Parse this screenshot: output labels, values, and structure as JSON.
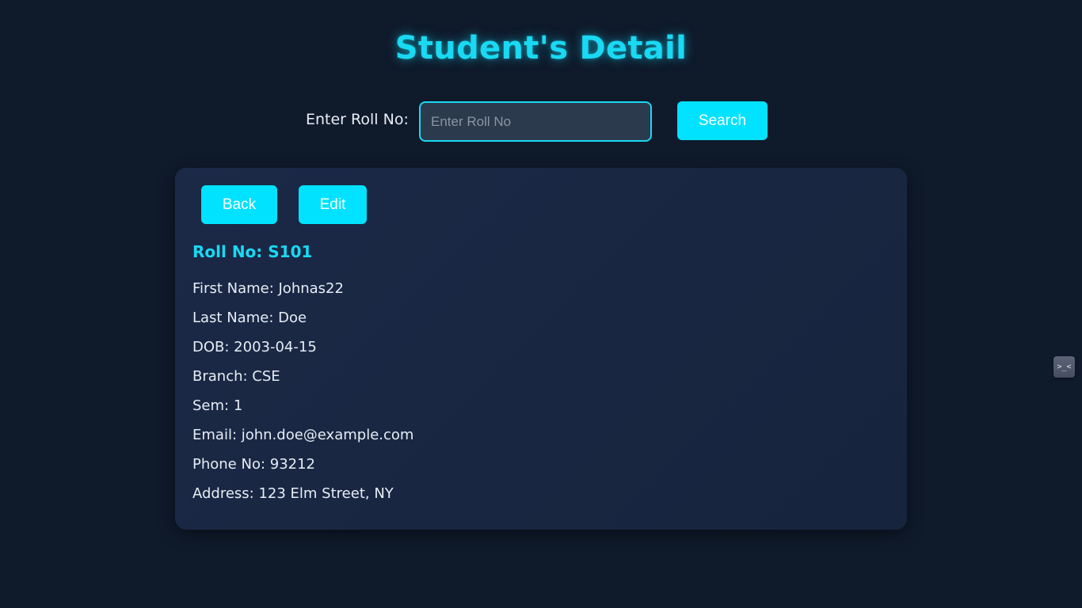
{
  "page": {
    "title": "Student's Detail"
  },
  "search": {
    "label": "Enter Roll No:",
    "placeholder": "Enter Roll No",
    "value": "",
    "button_label": "Search"
  },
  "card": {
    "back_label": "Back",
    "edit_label": "Edit",
    "roll_heading": "Roll No: S101",
    "details": [
      "First Name: Johnas22",
      "Last Name: Doe",
      "DOB: 2003-04-15",
      "Branch: CSE",
      "Sem: 1",
      "Email: john.doe@example.com",
      "Phone No: 93212",
      "Address: 123 Elm Street, NY"
    ]
  },
  "side_widget": {
    "icon": "extension-face-icon",
    "glyph": ">_<"
  },
  "colors": {
    "background": "#0f1a2b",
    "accent": "#19d9f3",
    "button": "#00e2ff",
    "card": "#1b2947"
  }
}
